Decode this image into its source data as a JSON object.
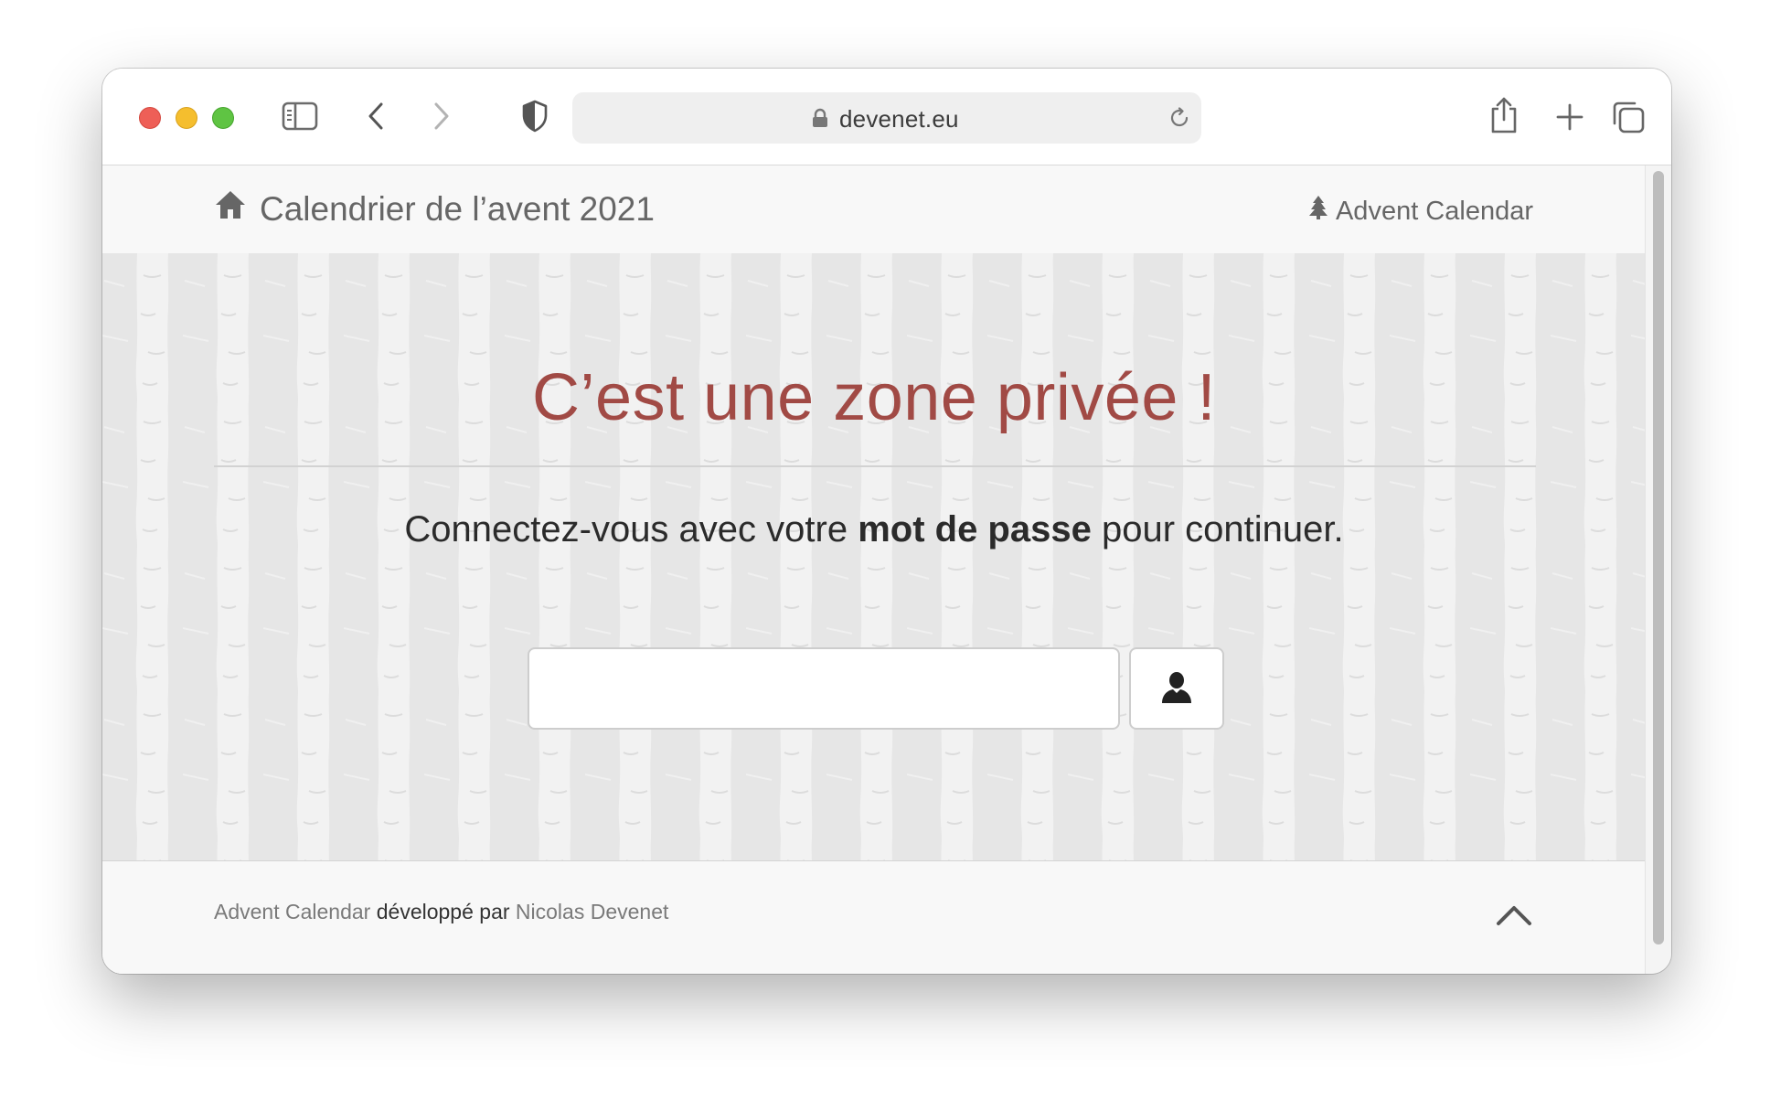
{
  "browser": {
    "url": "devenet.eu"
  },
  "site": {
    "brand_title": "Calendrier de l’avent 2021",
    "nav_link": "Advent Calendar"
  },
  "main": {
    "heading": "C’est une zone privée !",
    "lead_before": "Connectez-vous avec votre ",
    "lead_bold": "mot de passe",
    "lead_after": " pour continuer.",
    "password_value": ""
  },
  "footer": {
    "app_name": "Advent Calendar",
    "middle": " développé par ",
    "author": "Nicolas Devenet"
  },
  "colors": {
    "heading": "#a14a45",
    "muted": "#666666"
  },
  "icons": {
    "brand": "home-icon",
    "nav": "tree-icon",
    "submit": "user-icon",
    "back_to_top": "chevron-up-icon"
  }
}
